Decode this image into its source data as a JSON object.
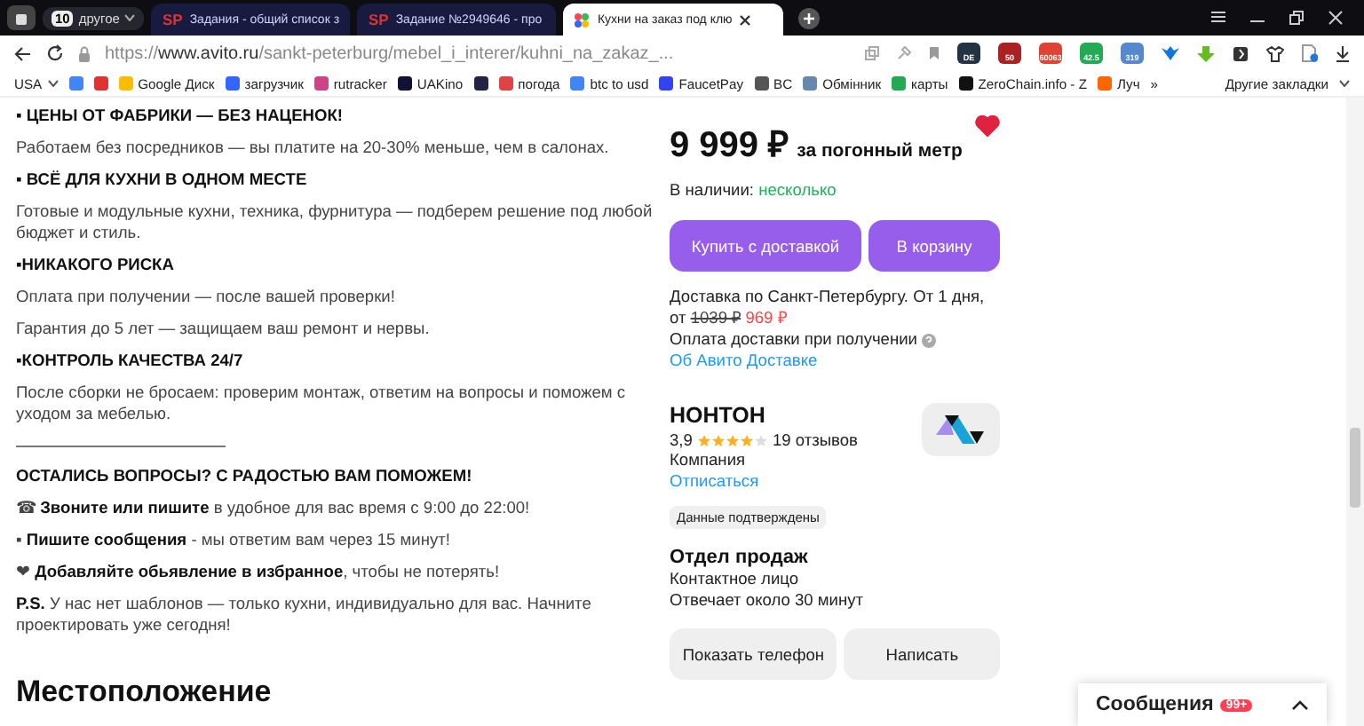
{
  "browser": {
    "tab_group": {
      "count": "10",
      "label": "другое"
    },
    "tabs": [
      {
        "favicon_text": "SP",
        "title": "Задания - общий список з",
        "selected": false
      },
      {
        "favicon_text": "SP",
        "title": "Задание №2949646 - про",
        "selected": false
      },
      {
        "title": "Кухни на заказ под клю",
        "selected": true
      }
    ],
    "url": "https://**www.avito.ru**/sankt-peterburg/mebel_i_interer/kuhni_na_zakaz_...",
    "extension_badges": [
      "DE",
      "50",
      "60063",
      "42.5",
      "319"
    ],
    "bookmarks": [
      {
        "kind": "menu",
        "label": "USA"
      },
      {
        "kind": "icon"
      },
      {
        "kind": "icon"
      },
      {
        "label": "Google Диск"
      },
      {
        "label": "загрузчик"
      },
      {
        "label": "rutracker"
      },
      {
        "label": "UAKino"
      },
      {
        "kind": "icon"
      },
      {
        "label": "погода"
      },
      {
        "label": "btc to usd"
      },
      {
        "label": "FaucetPay"
      },
      {
        "label": "BC"
      },
      {
        "label": "Обмінник"
      },
      {
        "label": "карты"
      },
      {
        "label": "ZeroChain.info - Z"
      },
      {
        "label": "Луч"
      }
    ],
    "bookmarks_more": "»",
    "other_bookmarks": "Другие закладки"
  },
  "description": [
    {
      "kind": "heading",
      "text": "▪ ЦЕНЫ ОТ ФАБРИКИ — БЕЗ НАЦЕНОК!"
    },
    {
      "kind": "text",
      "text": "Работаем без посредников — вы платите на 20-30% меньше, чем в салонах."
    },
    {
      "kind": "heading",
      "text": "▪ ВСЁ ДЛЯ КУХНИ В ОДНОМ МЕСТЕ"
    },
    {
      "kind": "text",
      "text": "Готовые и модульные кухни, техника, фурнитура — подберем решение под любой бюджет и стиль."
    },
    {
      "kind": "heading",
      "text": "▪НИКАКОГО РИСКА"
    },
    {
      "kind": "text",
      "text": "Оплата при получении — после вашей проверки!"
    },
    {
      "kind": "text",
      "text": "Гарантия до 5 лет — защищаем ваш ремонт и нервы."
    },
    {
      "kind": "heading",
      "text": "▪КОНТРОЛЬ КАЧЕСТВА 24/7"
    },
    {
      "kind": "text",
      "text": "После сборки не бросаем: проверим монтаж, ответим на вопросы и поможем с уходом за мебелью."
    },
    {
      "kind": "rule"
    },
    {
      "kind": "heading",
      "text": "ОСТАЛИСЬ ВОПРОСЫ? С РАДОСТЬЮ ВАМ ПОМОЖЕМ!"
    },
    {
      "kind": "text",
      "text": "☎ **Звоните или пишите** в удобное для вас время с 9:00 до 22:00!"
    },
    {
      "kind": "text",
      "text": "▪ **Пишите сообщения** - мы ответим вам через 15 минут!"
    },
    {
      "kind": "text",
      "text": "❤ **Добавляйте обьявление в избранное**, чтобы не потерять!"
    },
    {
      "kind": "text",
      "text": "**P.S.** У нас нет шаблонов — только кухни, индивидуально для вас. Начните проектировать уже сегодня!"
    }
  ],
  "location_title": "Местоположение",
  "offer": {
    "price": "9 999 ₽",
    "unit": "за погонный метр",
    "favorite": true,
    "availability_label": "В наличии:",
    "availability": "несколько",
    "buttons": [
      "Купить с доставкой",
      "В корзину"
    ],
    "delivery": "Доставка по Санкт-Петербургу. От 1 дня,",
    "delivery_from": "от",
    "old_price": "1039 ₽",
    "new_price": "969 ₽",
    "payment_note": "Оплата доставки при получении",
    "delivery_link": "Об Авито Доставке"
  },
  "seller": {
    "name": "НОНТОН",
    "rating": "3,9",
    "stars": 4,
    "reviews": "19 отзывов",
    "type": "Компания",
    "unsubscribe": "Отписаться",
    "verified_badge": "Данные подтверждены",
    "contact_name": "Отдел продаж",
    "contact_role": "Контактное лицо",
    "response_time": "Отвечает около 30 минут",
    "buttons": [
      "Показать телефон",
      "Написать"
    ]
  },
  "messages": {
    "label": "Сообщения",
    "badge": "99+"
  }
}
